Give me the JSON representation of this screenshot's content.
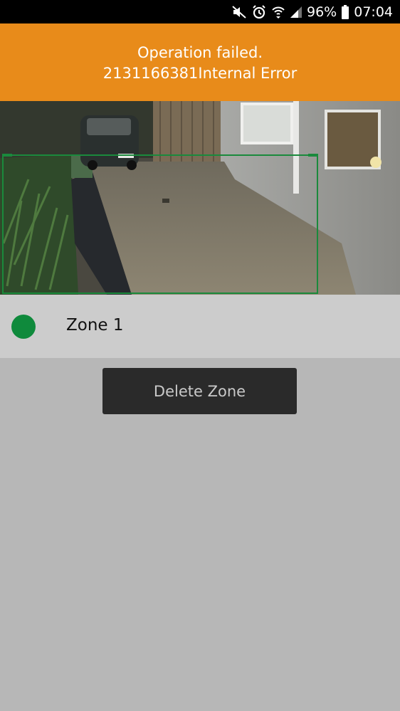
{
  "status_bar": {
    "battery_percent": "96%",
    "time": "07:04",
    "icons": [
      "mute-icon",
      "alarm-icon",
      "wifi-icon",
      "signal-icon",
      "battery-icon"
    ]
  },
  "banner": {
    "line1": "Operation failed.",
    "line2": "2131166381Internal Error",
    "color": "#e88b1a"
  },
  "camera": {
    "zone_color": "#1a8a3c"
  },
  "zone": {
    "name": "Zone 1",
    "dot_color": "#0f8a3c"
  },
  "actions": {
    "delete_label": "Delete Zone"
  }
}
